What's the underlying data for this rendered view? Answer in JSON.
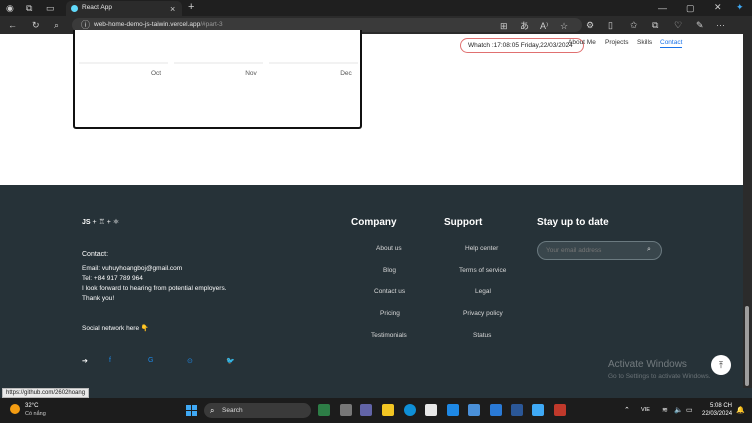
{
  "browser": {
    "tab_title": "React App",
    "tab_close": "×",
    "new_tab": "+",
    "url_host": "web-home-demo-js-taiwin.vercel.app",
    "url_path": "/#part-3",
    "read_aloud": "A⁾"
  },
  "chart_data": {
    "type": "line",
    "categories": [
      "Oct",
      "Nov",
      "Dec"
    ],
    "series": []
  },
  "nav": {
    "watch": "Whatch :17:08:05 Friday,22/03/2024",
    "about": "About Me",
    "projects": "Projects",
    "skills": "Skills",
    "contact": "Contact"
  },
  "footer": {
    "contact_heading": "Contact:",
    "email": "Email: vuhuyhoangboj@gmail.com",
    "tel": "Tel: +84 917 789 964",
    "message1": "I look forward to hearing from potential employers.",
    "message2": "Thank you!",
    "social_heading": "Social network here 👇",
    "company_heading": "Company",
    "company_links": [
      "About us",
      "Blog",
      "Contact us",
      "Pricing",
      "Testimonials"
    ],
    "support_heading": "Support",
    "support_links": [
      "Help center",
      "Terms of service",
      "Legal",
      "Privacy policy",
      "Status"
    ],
    "subscribe_heading": "Stay up to date",
    "email_placeholder": "Your email address"
  },
  "windows": {
    "activate_title": "Activate Windows",
    "activate_sub": "Go to Settings to activate Windows."
  },
  "status_url": "https://github.com/2602hoang",
  "taskbar": {
    "temp": "32°C",
    "weather": "Có nắng",
    "search": "Search",
    "lang": "VIE",
    "time": "5:08 CH",
    "date": "22/03/2024"
  },
  "colors": {
    "footer_bg": "#263238",
    "accent": "#1a73e8",
    "social": "#1e88e5"
  }
}
